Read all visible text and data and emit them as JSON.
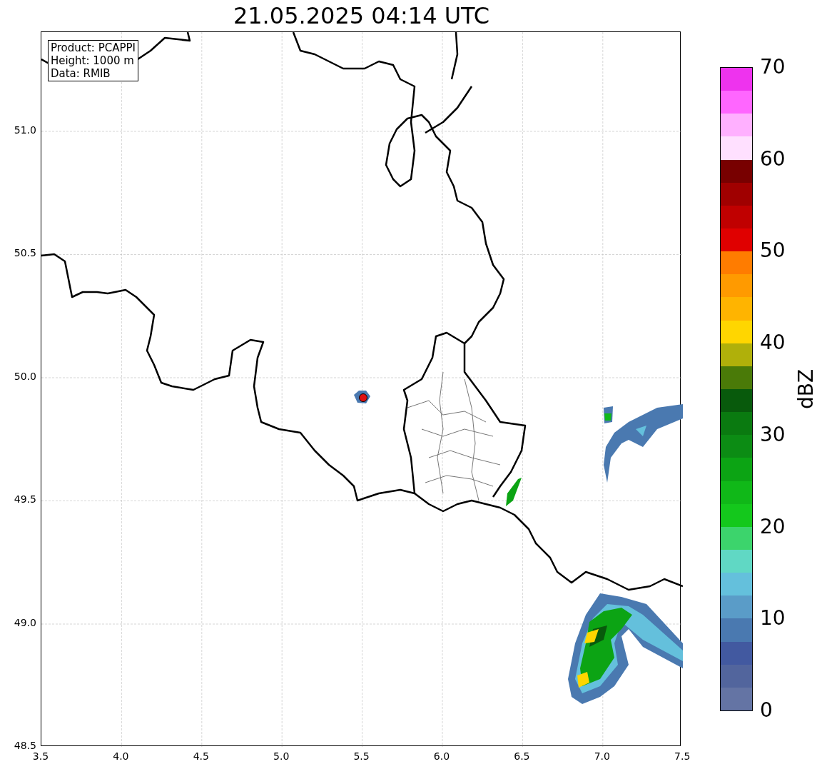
{
  "title": "21.05.2025 04:14 UTC",
  "info_box": [
    "Product: PCAPPI",
    "Height: 1000 m",
    "Data: RMIB"
  ],
  "map": {
    "xticks": [
      "3.5",
      "4.0",
      "4.5",
      "5.0",
      "5.5",
      "6.0",
      "6.5",
      "7.0",
      "7.5"
    ],
    "yticks": [
      "51.0",
      "50.5",
      "50.0",
      "49.5",
      "49.0",
      "48.5"
    ]
  },
  "colorbar": {
    "label": "dBZ",
    "ticks": [
      "70",
      "60",
      "50",
      "40",
      "30",
      "20",
      "10",
      "0"
    ],
    "bands": [
      {
        "color": "#6474a4"
      },
      {
        "color": "#52659d"
      },
      {
        "color": "#4259a0"
      },
      {
        "color": "#4a79b0"
      },
      {
        "color": "#5a9cc8"
      },
      {
        "color": "#64c0dc"
      },
      {
        "color": "#60d8c4"
      },
      {
        "color": "#3cd46c"
      },
      {
        "color": "#14c81c"
      },
      {
        "color": "#10b818"
      },
      {
        "color": "#0ca414"
      },
      {
        "color": "#0c8c14"
      },
      {
        "color": "#0a7a10"
      },
      {
        "color": "#085a0c"
      },
      {
        "color": "#4a7a08"
      },
      {
        "color": "#b0b00a"
      },
      {
        "color": "#ffd600"
      },
      {
        "color": "#ffb400"
      },
      {
        "color": "#ff9a00"
      },
      {
        "color": "#ff7c00"
      },
      {
        "color": "#e00000"
      },
      {
        "color": "#c00000"
      },
      {
        "color": "#a00000"
      },
      {
        "color": "#780000"
      },
      {
        "color": "#ffe0ff"
      },
      {
        "color": "#ffb0ff"
      },
      {
        "color": "#ff66ff"
      },
      {
        "color": "#ee33ee"
      }
    ]
  }
}
